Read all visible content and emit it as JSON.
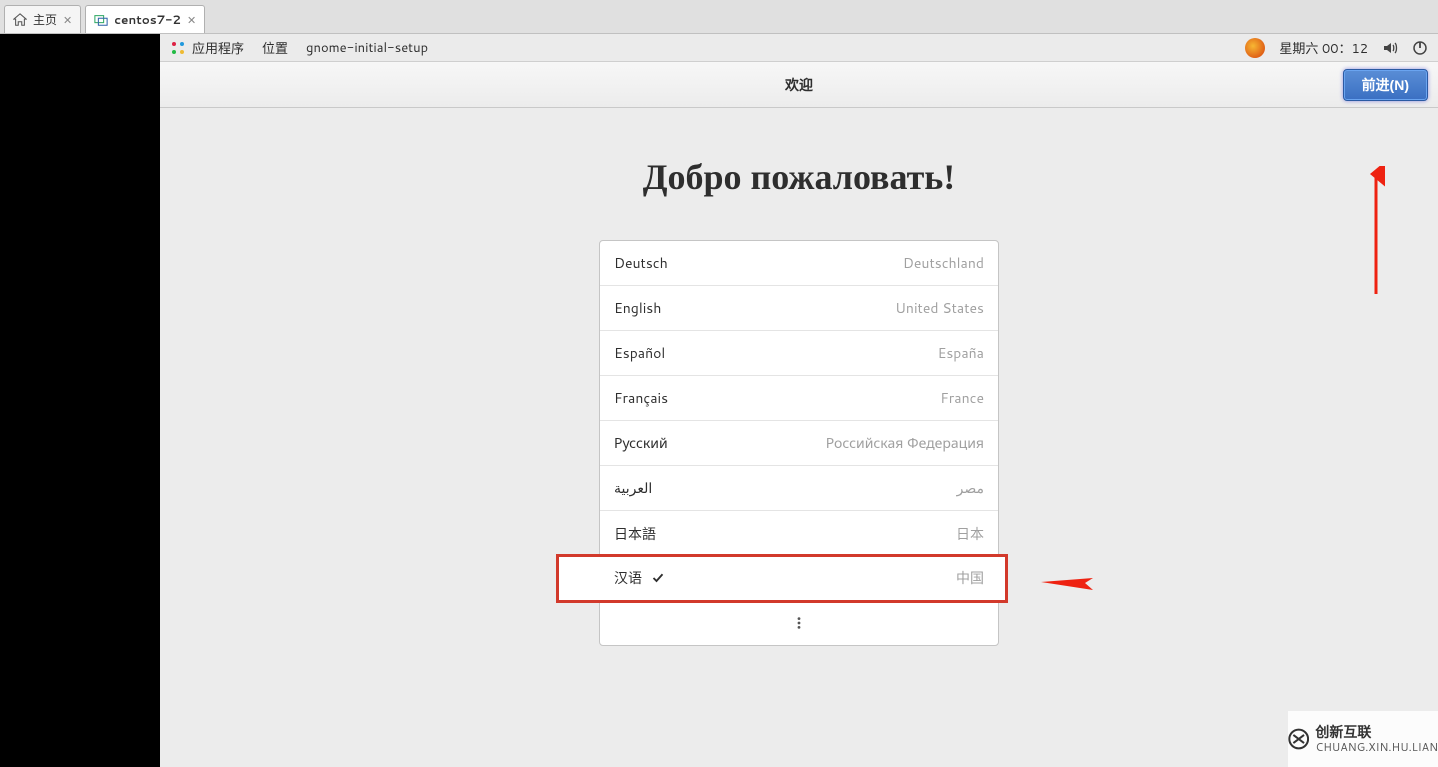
{
  "host": {
    "tabs": [
      {
        "label": "主页",
        "active": false
      },
      {
        "label": "centos7-2",
        "active": true
      }
    ]
  },
  "gnome_bar": {
    "apps_label": "应用程序",
    "places_label": "位置",
    "app_name": "gnome-initial-setup",
    "clock": "星期六 00：12"
  },
  "wizard": {
    "header_title": "欢迎",
    "next_label": "前进(N)",
    "welcome_heading": "Добро пожаловать!"
  },
  "languages": [
    {
      "lang": "Deutsch",
      "region": "Deutschland",
      "selected": false
    },
    {
      "lang": "English",
      "region": "United States",
      "selected": false
    },
    {
      "lang": "Español",
      "region": "España",
      "selected": false
    },
    {
      "lang": "Français",
      "region": "France",
      "selected": false
    },
    {
      "lang": "Русский",
      "region": "Российская Федерация",
      "selected": false
    },
    {
      "lang": "العربية",
      "region": "مصر",
      "selected": false
    },
    {
      "lang": "日本語",
      "region": "日本",
      "selected": false
    },
    {
      "lang": "汉语",
      "region": "中国",
      "selected": true
    }
  ],
  "watermark": {
    "brand_cn": "创新互联",
    "brand_py": "CHUANG.XIN.HU.LIAN"
  }
}
